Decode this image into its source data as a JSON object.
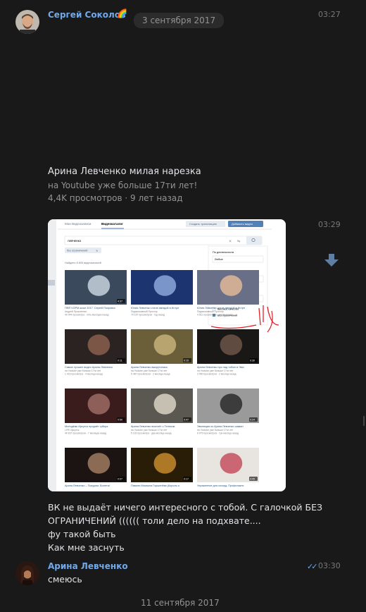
{
  "messages": {
    "first": {
      "author": "Сергей Соколов",
      "author_badge": "🌈",
      "time": "03:27",
      "date_pill": "3 сентября 2017"
    },
    "video": {
      "title": "Арина Левченко милая нарезка",
      "subtitle": "на Youtube уже больше 17ти лет!",
      "stats": "4,4K просмотров · 9 лет назад"
    },
    "second": {
      "time": "03:29",
      "text_lines": [
        "ВК не выдаёт ничего интересного с тобой. С галочкой БЕЗ",
        "ОГРАНИЧЕНИЙ (((((( толи дело на подхвате....",
        "фу такой быть",
        "Как мне заснуть"
      ]
    },
    "third": {
      "author": "Арина Левченко",
      "time": "03:30",
      "text": "смеюсь"
    },
    "date_bottom": "11 сентября 2017"
  },
  "screenshot": {
    "tabs": [
      "Мои Видеозаписи",
      "Видеокаталог"
    ],
    "create_stream": "Создать трансляцию",
    "add_video": "Добавить видео",
    "search_value": "левченко",
    "filter_tag": "без ограничений",
    "found": "Найдено 8 805 видеозаписей",
    "filters": {
      "duration_label": "По длительности",
      "duration_value": "Любые",
      "date_label": "По дате",
      "date_value": "За любое время",
      "sort_label": "Сортировка",
      "sort_value": "По релевантности",
      "hq_label": "Высокое качество",
      "safe_label": "Без ограничений"
    },
    "videos": [
      {
        "title": "ПЕЙ ЧОРМ шоке 2017. Сергей Покровск",
        "channel": "Андрей Прокопенко",
        "views": "40 044 просмотра · пять месяцев назад",
        "duration": "4:37",
        "theme": "navy"
      },
      {
        "title": "Юлия Левченко стала звездой в Истре",
        "channel": "Подмосковный Простор",
        "views": "70 157 просмотров · год назад",
        "duration": "",
        "theme": "blue"
      },
      {
        "title": "Юлия Левченко стала звездой в Истре",
        "channel": "Подмосковный Простор",
        "views": "4 511 просмотров · месяц назад",
        "duration": "",
        "theme": "face"
      },
      {
        "title": "Самое лучшее видео Арины Левченко",
        "channel": "на Youtube уже больше 17ти лет",
        "views": "1 423 просмотра · 4 месяца назад",
        "duration": "0:11",
        "theme": "dark"
      },
      {
        "title": "Арина Левченко выкрутилась",
        "channel": "на Youtube уже больше 17ти лет",
        "views": "9 487 просмотров · 2 месяца назад",
        "duration": "0:15",
        "theme": "meerkat"
      },
      {
        "title": "Арина Левченко прс над тобою в Эми",
        "channel": "на Youtube уже больше 17ти лет",
        "views": "2 950 просмотров · 2 месяца назад",
        "duration": "0:30",
        "theme": "dark2"
      },
      {
        "title": "Молодёжь Иркутск продаёт губера",
        "channel": "LIFE Иркутск",
        "views": "49 637 просмотров · 7 месяцев назад",
        "duration": "0:50",
        "theme": "red"
      },
      {
        "title": "Арина Левченко воспоёт с Телеком",
        "channel": "на Youtube уже больше 17ти лет",
        "views": "5 102 просмотра · два месяца назад",
        "duration": "0:47",
        "theme": "room"
      },
      {
        "title": "Эволюция из Арина Левченко шаман",
        "channel": "на Youtube уже больше 17ти лет",
        "views": "6 079 просмотров · три месяца назад",
        "duration": "0:24",
        "theme": "bw"
      },
      {
        "title": "Арина Левченко – Покурим. Билеты!",
        "channel": "",
        "views": "",
        "duration": "0:07",
        "theme": "dark3"
      },
      {
        "title": "Памяти Михаила Горшенёва (Король и",
        "channel": "",
        "views": "",
        "duration": "0:17",
        "theme": "gold"
      },
      {
        "title": "Упражнение для кохорд. Профилакти",
        "channel": "",
        "views": "",
        "duration": "4:45",
        "theme": "white"
      }
    ]
  },
  "colors": {
    "background": "#19191a",
    "accent": "#71aaeb",
    "text": "#e1e3e6",
    "muted": "#939393"
  }
}
